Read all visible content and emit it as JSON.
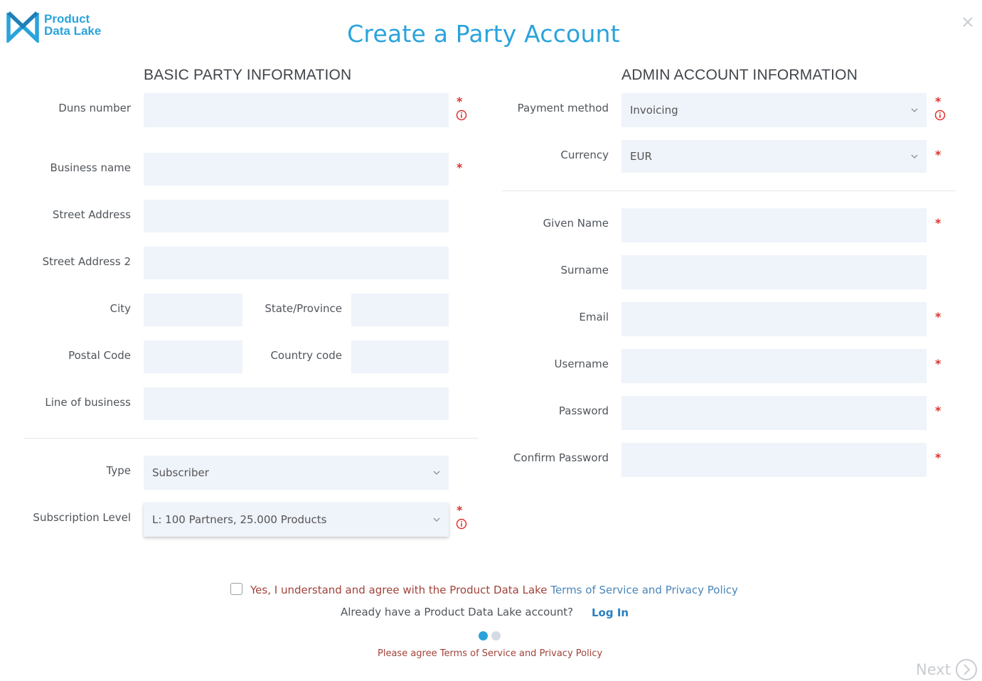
{
  "brand": {
    "line1": "Product",
    "line2": "Data Lake",
    "color": "#2aa3dc"
  },
  "page_title": "Create a Party Account",
  "close_icon": "close-icon",
  "basic": {
    "heading": "BASIC PARTY INFORMATION",
    "duns_label": "Duns number",
    "duns_value": "",
    "business_label": "Business name",
    "business_value": "",
    "street_label": "Street Address",
    "street_value": "",
    "street2_label": "Street Address 2",
    "street2_value": "",
    "city_label": "City",
    "city_value": "",
    "state_label": "State/Province",
    "state_value": "",
    "postal_label": "Postal Code",
    "postal_value": "",
    "country_label": "Country code",
    "country_value": "",
    "lob_label": "Line of business",
    "lob_value": "",
    "type_label": "Type",
    "type_value": "Subscriber",
    "sub_label": "Subscription Level",
    "sub_value": "L: 100 Partners, 25.000 Products"
  },
  "admin": {
    "heading": "ADMIN ACCOUNT INFORMATION",
    "payment_label": "Payment method",
    "payment_value": "Invoicing",
    "currency_label": "Currency",
    "currency_value": "EUR",
    "given_label": "Given Name",
    "given_value": "",
    "surname_label": "Surname",
    "surname_value": "",
    "email_label": "Email",
    "email_value": "",
    "username_label": "Username",
    "username_value": "",
    "password_label": "Password",
    "password_value": "",
    "confirm_label": "Confirm Password",
    "confirm_value": ""
  },
  "required_mark": "*",
  "footer": {
    "agree_text": "Yes, I understand and agree with the Product Data Lake",
    "terms_link": "Terms of Service and Privacy Policy",
    "already_text": "Already have a Product Data Lake account?",
    "login_link": "Log In",
    "warning": "Please agree Terms of Service and Privacy Policy",
    "next_label": "Next",
    "agree_checked": false
  },
  "colors": {
    "accent": "#2aa3dc",
    "required": "#e0302b",
    "field_bg": "#eff3fa",
    "warning": "#a0433a",
    "link": "#2a7fc0"
  }
}
